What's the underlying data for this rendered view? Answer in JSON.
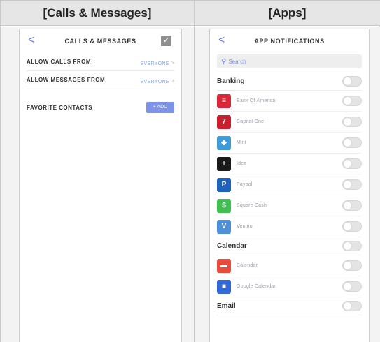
{
  "headers": {
    "left": "[Calls & Messages]",
    "right": "[Apps]"
  },
  "calls_screen": {
    "back": "<",
    "title": "CALLS & MESSAGES",
    "check": "✓",
    "rows": [
      {
        "label": "ALLOW CALLS FROM",
        "value": "EVERYONE"
      },
      {
        "label": "ALLOW MESSAGES FROM",
        "value": "EVERYONE"
      }
    ],
    "favorites_label": "FAVORITE CONTACTS",
    "add_button": "+ ADD"
  },
  "apps_screen": {
    "back": "<",
    "title": "APP NOTIFICATIONS",
    "search_placeholder": "Search",
    "sections": {
      "banking": "Banking",
      "calendar": "Calendar",
      "email": "Email"
    },
    "banking_apps": [
      {
        "name": "Bank Of America",
        "icon": "bank-of-america-icon",
        "color": "#d9283a",
        "glyph": "≡",
        "enabled": false
      },
      {
        "name": "Capital One",
        "icon": "capital-one-icon",
        "color": "#c8202f",
        "glyph": "7",
        "enabled": false
      },
      {
        "name": "Mint",
        "icon": "mint-icon",
        "color": "#3f9ad8",
        "glyph": "◆",
        "enabled": false
      },
      {
        "name": "Idea",
        "icon": "idea-icon",
        "color": "#1a1a1a",
        "glyph": "+",
        "enabled": false
      },
      {
        "name": "Paypal",
        "icon": "paypal-icon",
        "color": "#1f62b9",
        "glyph": "P",
        "enabled": false
      },
      {
        "name": "Square Cash",
        "icon": "square-cash-icon",
        "color": "#3fbf4f",
        "glyph": "$",
        "enabled": false
      },
      {
        "name": "Venmo",
        "icon": "venmo-icon",
        "color": "#4b90d9",
        "glyph": "V",
        "enabled": false
      }
    ],
    "calendar_apps": [
      {
        "name": "Calendar",
        "icon": "calendar-icon",
        "color": "#e94b3c",
        "glyph": "▬",
        "enabled": false
      },
      {
        "name": "Google Calendar",
        "icon": "google-calendar-icon",
        "color": "#3369d6",
        "glyph": "■",
        "enabled": false
      }
    ]
  }
}
